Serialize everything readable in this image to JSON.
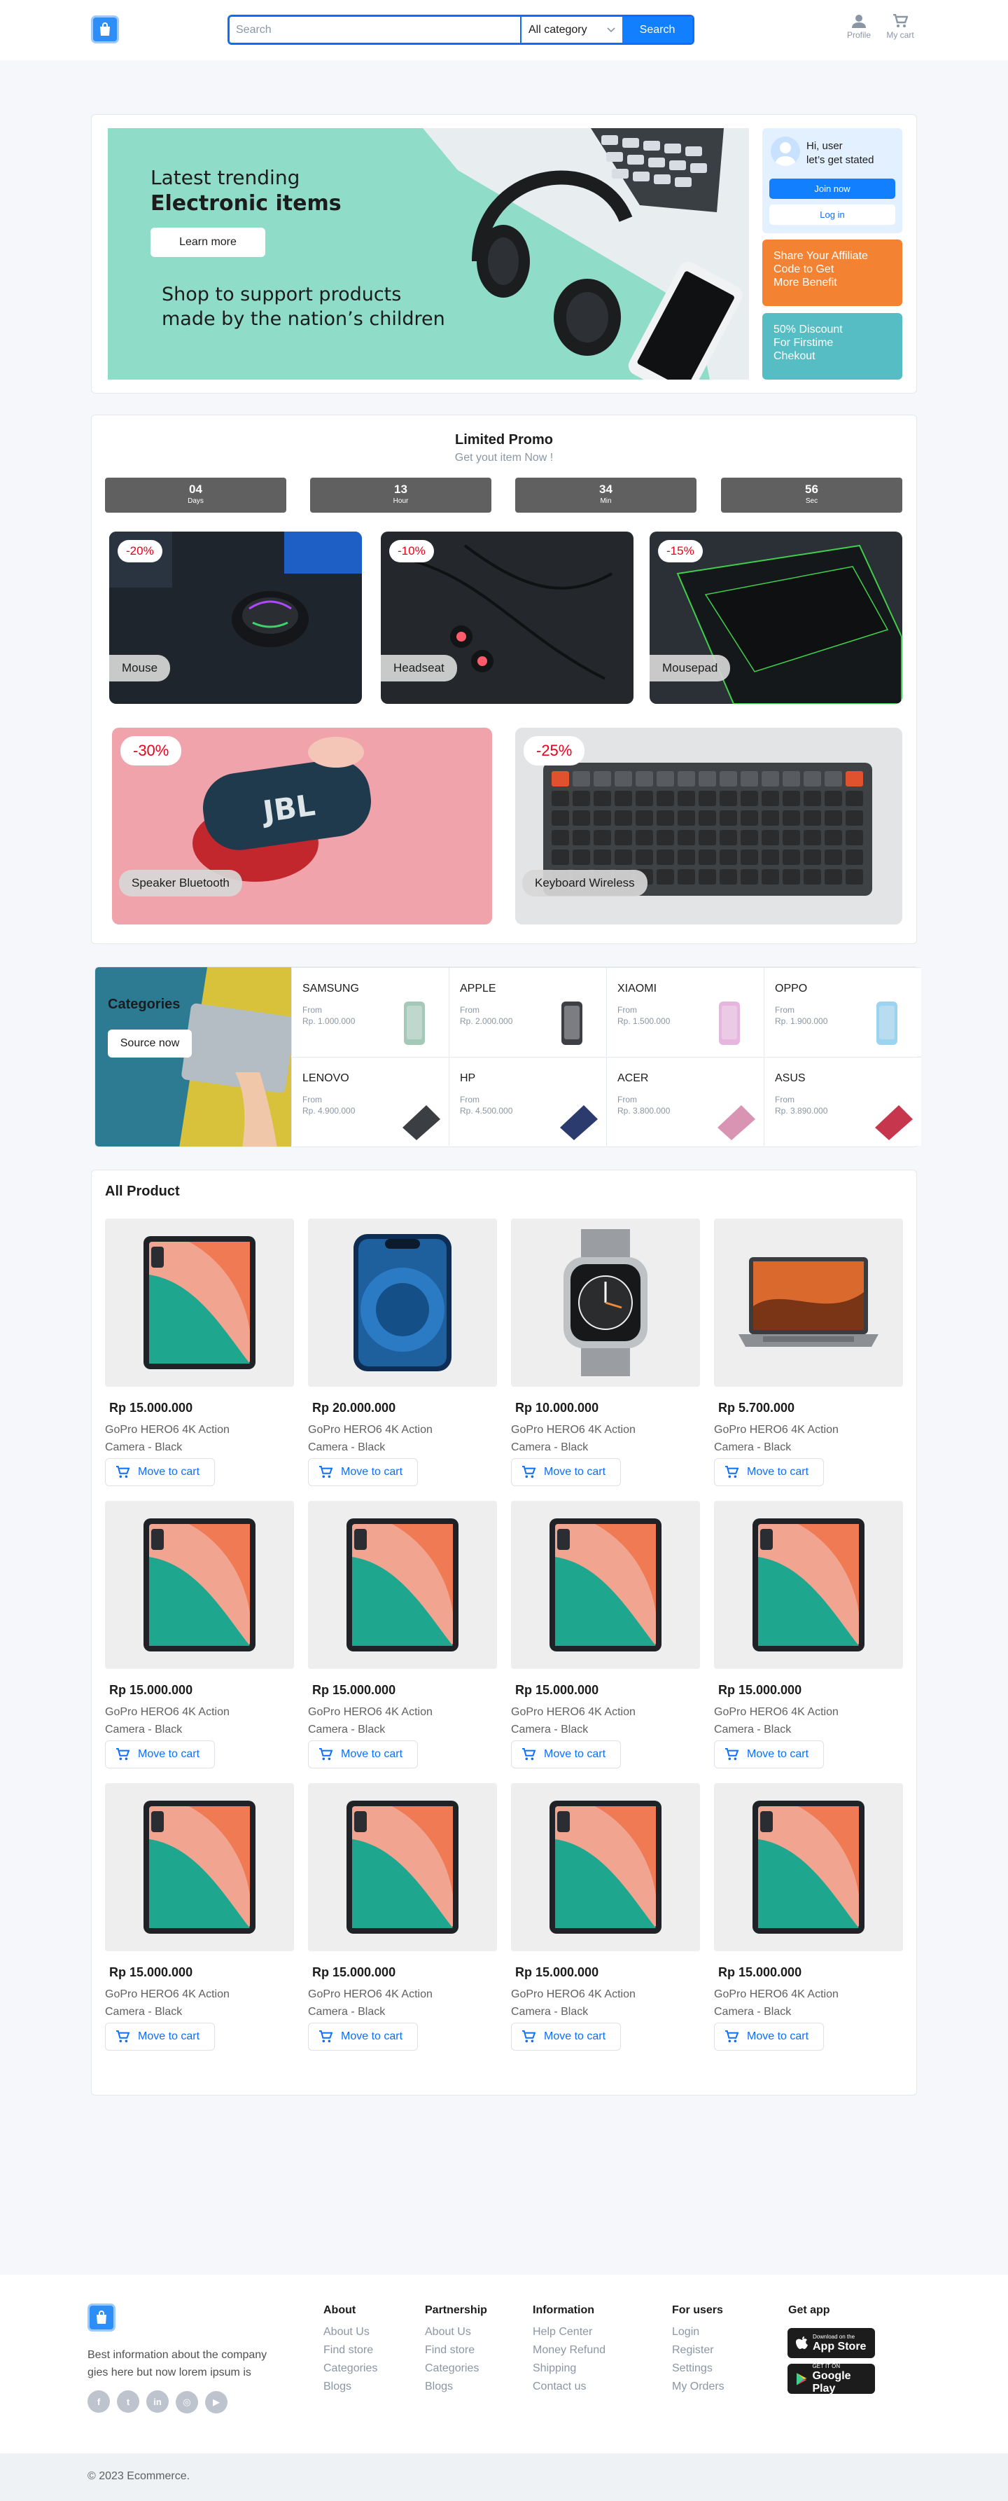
{
  "header": {
    "search_placeholder": "Search",
    "category": "All category",
    "search_btn": "Search",
    "profile": "Profile",
    "cart": "My cart"
  },
  "hero": {
    "line1": "Latest trending",
    "line2": "Electronic items",
    "learn_btn": "Learn more",
    "tagline1": "Shop to support products",
    "tagline2": "made by the nation’s children",
    "user_hi1": "Hi, user",
    "user_hi2": "let’s get stated",
    "join_btn": "Join now",
    "login_btn": "Log in",
    "affiliate1": "Share Your Affiliate",
    "affiliate2": "Code to Get",
    "affiliate3": "More Benefit",
    "discount1": "50% Discount",
    "discount2": "For Firstime",
    "discount3": "Chekout"
  },
  "promo": {
    "title": "Limited Promo",
    "subtitle": "Get yout item Now !",
    "countdown": [
      {
        "num": "04",
        "unit": "Days"
      },
      {
        "num": "13",
        "unit": "Hour"
      },
      {
        "num": "34",
        "unit": "Min"
      },
      {
        "num": "56",
        "unit": "Sec"
      }
    ],
    "items": [
      {
        "discount": "-20%",
        "name": "Mouse"
      },
      {
        "discount": "-10%",
        "name": "Headseat"
      },
      {
        "discount": "-15%",
        "name": "Mousepad"
      },
      {
        "discount": "-30%",
        "name": "Speaker Bluetooth"
      },
      {
        "discount": "-25%",
        "name": "Keyboard Wireless"
      }
    ]
  },
  "categories": {
    "title": "Categories",
    "btn": "Source now",
    "items": [
      {
        "name": "SAMSUNG",
        "from": "From",
        "price": "Rp. 1.000.000"
      },
      {
        "name": "APPLE",
        "from": "From",
        "price": "Rp. 2.000.000"
      },
      {
        "name": "XIAOMI",
        "from": "From",
        "price": "Rp. 1.500.000"
      },
      {
        "name": "OPPO",
        "from": "From",
        "price": "Rp. 1.900.000"
      },
      {
        "name": "LENOVO",
        "from": "From",
        "price": "Rp. 4.900.000"
      },
      {
        "name": "HP",
        "from": "From",
        "price": "Rp. 4.500.000"
      },
      {
        "name": "ACER",
        "from": "From",
        "price": "Rp. 3.800.000"
      },
      {
        "name": "ASUS",
        "from": "From",
        "price": "Rp. 3.890.000"
      }
    ]
  },
  "products": {
    "title": "All Product",
    "cart_label": "Move to cart",
    "items": [
      {
        "price": "Rp 15.000.000",
        "name": "GoPro HERO6 4K Action Camera - Black",
        "img": "tablet"
      },
      {
        "price": "Rp 20.000.000",
        "name": "GoPro HERO6 4K Action Camera - Black",
        "img": "phone"
      },
      {
        "price": "Rp 10.000.000",
        "name": "GoPro HERO6 4K Action Camera - Black",
        "img": "watch"
      },
      {
        "price": "Rp 5.700.000",
        "name": "GoPro HERO6 4K Action Camera - Black",
        "img": "laptop"
      },
      {
        "price": "Rp 15.000.000",
        "name": "GoPro HERO6 4K Action Camera - Black",
        "img": "tablet"
      },
      {
        "price": "Rp 15.000.000",
        "name": "GoPro HERO6 4K Action Camera - Black",
        "img": "tablet"
      },
      {
        "price": "Rp 15.000.000",
        "name": "GoPro HERO6 4K Action Camera - Black",
        "img": "tablet"
      },
      {
        "price": "Rp 15.000.000",
        "name": "GoPro HERO6 4K Action Camera - Black",
        "img": "tablet"
      },
      {
        "price": "Rp 15.000.000",
        "name": "GoPro HERO6 4K Action Camera - Black",
        "img": "tablet"
      },
      {
        "price": "Rp 15.000.000",
        "name": "GoPro HERO6 4K Action Camera - Black",
        "img": "tablet"
      },
      {
        "price": "Rp 15.000.000",
        "name": "GoPro HERO6 4K Action Camera - Black",
        "img": "tablet"
      },
      {
        "price": "Rp 15.000.000",
        "name": "GoPro HERO6 4K Action Camera - Black",
        "img": "tablet"
      }
    ]
  },
  "footer": {
    "desc1": "Best information about the company",
    "desc2": "gies here but now lorem ipsum is",
    "social": [
      "facebook-icon",
      "twitter-icon",
      "linkedin-icon",
      "instagram-icon",
      "youtube-icon"
    ],
    "columns": [
      {
        "title": "About",
        "links": [
          "About Us",
          "Find store",
          "Categories",
          "Blogs"
        ]
      },
      {
        "title": "Partnership",
        "links": [
          "About Us",
          "Find store",
          "Categories",
          "Blogs"
        ]
      },
      {
        "title": "Information",
        "links": [
          "Help Center",
          "Money Refund",
          "Shipping",
          "Contact us"
        ]
      },
      {
        "title": "For users",
        "links": [
          "Login",
          "Register",
          "Settings",
          "My Orders"
        ]
      }
    ],
    "app_title": "Get app",
    "appstore_small": "Download on the",
    "appstore_big": "App Store",
    "gplay_small": "GET IT ON",
    "gplay_big": "Google Play",
    "copyright": "© 2023 Ecommerce."
  },
  "colors": {
    "primary": "#127fff",
    "orange": "#f38332",
    "teal": "#55bdc3",
    "hero_bg": "#8fdcc8",
    "price_red": "#eb001b"
  }
}
